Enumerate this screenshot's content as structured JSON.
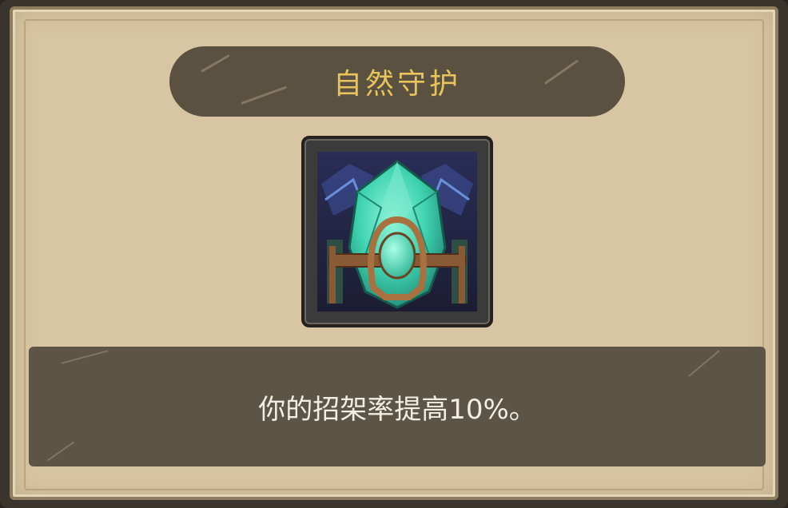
{
  "tooltip": {
    "title": "自然守护",
    "icon": "emerald-shield-icon",
    "description": "你的招架率提高10%。"
  },
  "colors": {
    "title_text": "#e8c45a",
    "panel_bg": "#d8c5a3",
    "bar_bg": "#5a5141",
    "desc_text": "#f1ede4",
    "gem": "#3fd3b0"
  }
}
